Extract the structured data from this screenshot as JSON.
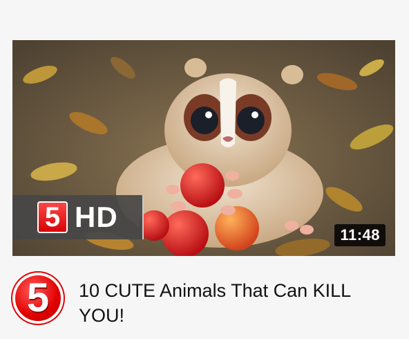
{
  "video": {
    "title": "10 CUTE Animals That Can KILL YOU!",
    "duration": "11:48",
    "thumbnail_subject": "fluffy slow loris toy holding red apples on autumn leaves"
  },
  "channel": {
    "logo_text": "5",
    "badge_number": "5",
    "badge_quality": "HD"
  },
  "colors": {
    "brand_red": "#e00000",
    "badge_gray": "#464646",
    "background": "#f6f6f6"
  }
}
